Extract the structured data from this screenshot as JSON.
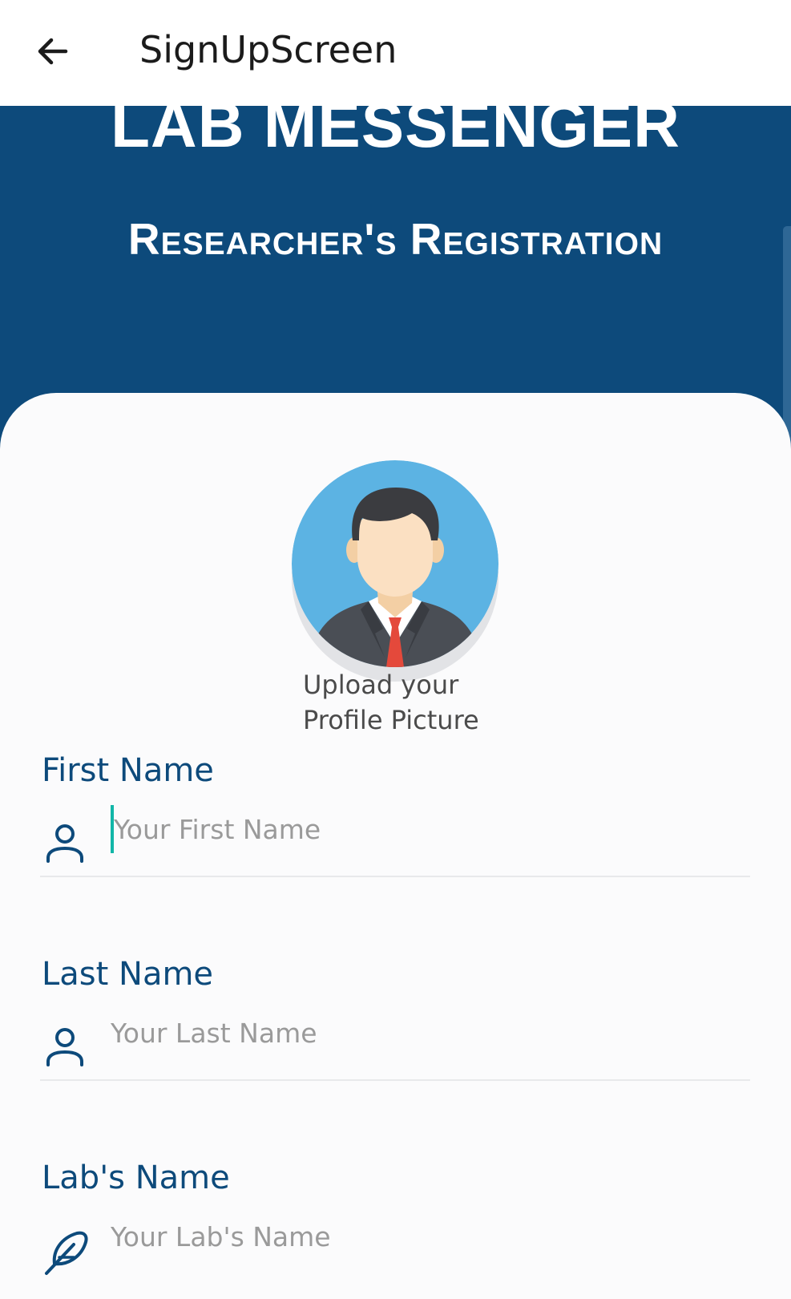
{
  "app_bar": {
    "title": "SignUpScreen",
    "back_icon": "arrow-left-icon"
  },
  "header": {
    "title": "LAB MESSENGER",
    "subtitle": "Researcher's Registration",
    "background_color": "#0d4a7b"
  },
  "profile": {
    "upload_label": "Upload your\nProfile Picture",
    "avatar_icon": "businessman-avatar-icon"
  },
  "form": {
    "fields": [
      {
        "label": "First Name",
        "placeholder": "Your First Name",
        "value": "",
        "icon": "person-icon",
        "focused": true
      },
      {
        "label": "Last Name",
        "placeholder": "Your Last Name",
        "value": "",
        "icon": "person-icon",
        "focused": false
      },
      {
        "label": "Lab's Name",
        "placeholder": "Your Lab's Name",
        "value": "",
        "icon": "feather-icon",
        "focused": false
      }
    ]
  },
  "colors": {
    "accent": "#0d4a7b",
    "cursor": "#12b6a8",
    "placeholder": "#9a9a9a"
  }
}
